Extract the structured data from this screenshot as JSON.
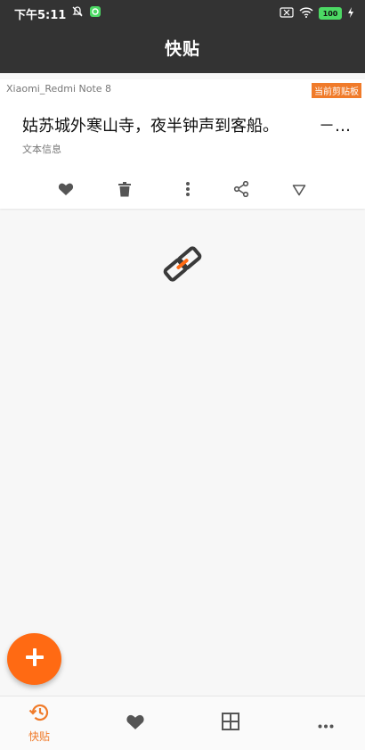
{
  "status": {
    "time": "下午5:11",
    "battery": "100"
  },
  "app": {
    "title": "快贴"
  },
  "card": {
    "device": "Xiaomi_Redmi Note 8",
    "badge": "当前剪贴板",
    "content": "姑苏城外寒山寺，夜半钟声到客船。",
    "more": "－…",
    "type": "文本信息",
    "actions": [
      "favorite-icon",
      "delete-icon",
      "more-vert-icon",
      "share-icon",
      "collapse-icon"
    ]
  },
  "center_icon": "link-icon",
  "fab": {
    "icon": "plus-icon"
  },
  "bottom_nav": {
    "items": [
      {
        "label": "快贴",
        "icon": "history-icon",
        "active": true
      },
      {
        "label": "",
        "icon": "heart-icon",
        "active": false
      },
      {
        "label": "",
        "icon": "grid-icon",
        "active": false
      },
      {
        "label": "",
        "icon": "more-horiz-icon",
        "active": false
      }
    ]
  },
  "colors": {
    "accent": "#f07b2a",
    "fab": "#ff6a13",
    "header": "#333333",
    "icon": "#555555"
  }
}
